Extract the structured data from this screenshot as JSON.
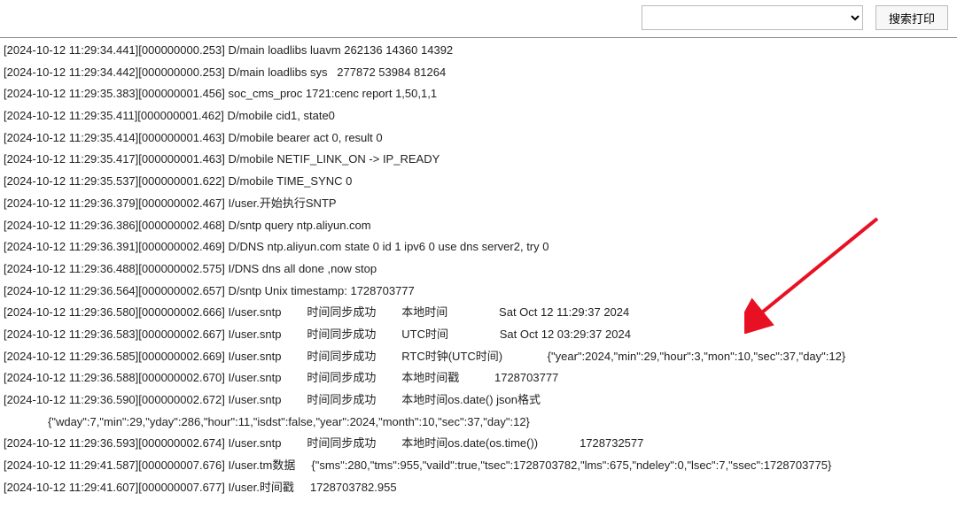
{
  "toolbar": {
    "search_placeholder": "",
    "search_button_label": "搜索打印"
  },
  "log_lines": [
    "[2024-10-12 11:29:34.441][000000000.253] D/main loadlibs luavm 262136 14360 14392",
    "[2024-10-12 11:29:34.442][000000000.253] D/main loadlibs sys   277872 53984 81264",
    "[2024-10-12 11:29:35.383][000000001.456] soc_cms_proc 1721:cenc report 1,50,1,1",
    "[2024-10-12 11:29:35.411][000000001.462] D/mobile cid1, state0",
    "[2024-10-12 11:29:35.414][000000001.463] D/mobile bearer act 0, result 0",
    "[2024-10-12 11:29:35.417][000000001.463] D/mobile NETIF_LINK_ON -> IP_READY",
    "[2024-10-12 11:29:35.537][000000001.622] D/mobile TIME_SYNC 0",
    "[2024-10-12 11:29:36.379][000000002.467] I/user.开始执行SNTP",
    "[2024-10-12 11:29:36.386][000000002.468] D/sntp query ntp.aliyun.com",
    "[2024-10-12 11:29:36.391][000000002.469] D/DNS ntp.aliyun.com state 0 id 1 ipv6 0 use dns server2, try 0",
    "[2024-10-12 11:29:36.488][000000002.575] I/DNS dns all done ,now stop",
    "[2024-10-12 11:29:36.564][000000002.657] D/sntp Unix timestamp: 1728703777",
    "[2024-10-12 11:29:36.580][000000002.666] I/user.sntp        时间同步成功        本地时间                Sat Oct 12 11:29:37 2024",
    "[2024-10-12 11:29:36.583][000000002.667] I/user.sntp        时间同步成功        UTC时间                Sat Oct 12 03:29:37 2024",
    "[2024-10-12 11:29:36.585][000000002.669] I/user.sntp        时间同步成功        RTC时钟(UTC时间)              {\"year\":2024,\"min\":29,\"hour\":3,\"mon\":10,\"sec\":37,\"day\":12}",
    "[2024-10-12 11:29:36.588][000000002.670] I/user.sntp        时间同步成功        本地时间戳           1728703777",
    "[2024-10-12 11:29:36.590][000000002.672] I/user.sntp        时间同步成功        本地时间os.date() json格式",
    "{\"wday\":7,\"min\":29,\"yday\":286,\"hour\":11,\"isdst\":false,\"year\":2024,\"month\":10,\"sec\":37,\"day\":12}",
    "[2024-10-12 11:29:36.593][000000002.674] I/user.sntp        时间同步成功        本地时间os.date(os.time())             1728732577",
    "[2024-10-12 11:29:41.587][000000007.676] I/user.tm数据     {\"sms\":280,\"tms\":955,\"vaild\":true,\"tsec\":1728703782,\"lms\":675,\"ndeley\":0,\"lsec\":7,\"ssec\":1728703775}",
    "[2024-10-12 11:29:41.607][000000007.677] I/user.时间戳     1728703782.955"
  ],
  "log_indented_indices": [
    17
  ],
  "annotation": {
    "arrow_color": "#e81123"
  }
}
